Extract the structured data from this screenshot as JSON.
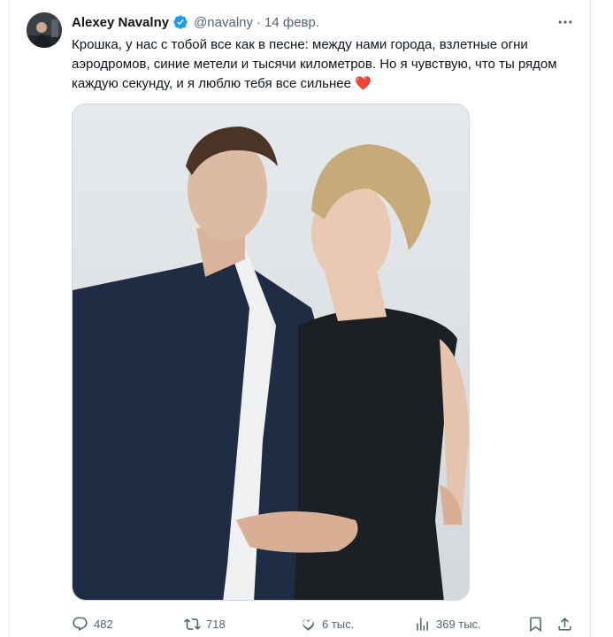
{
  "tweet": {
    "author_name": "Alexey Navalny",
    "handle": "@navalny",
    "separator": "·",
    "date": "14 февр.",
    "text": "Крошка, у нас с тобой все как в песне: между нами города, взлетные огни аэродромов, синие метели и тысячи километров. Но я чувствую, что ты рядом каждую секунду, и я люблю тебя все сильнее",
    "emoji": "❤️",
    "verified": true
  },
  "actions": {
    "replies": "482",
    "retweets": "718",
    "likes": "6 тыс.",
    "views": "369 тыс."
  },
  "icons": {
    "more": "more-horizontal-icon",
    "reply": "reply-icon",
    "retweet": "retweet-icon",
    "like": "heart-icon",
    "views": "views-bar-chart-icon",
    "bookmark": "bookmark-icon",
    "share": "share-icon"
  },
  "colors": {
    "text_primary": "#0f1419",
    "text_secondary": "#536471",
    "verified_blue": "#1d9bf0",
    "border": "#cfd9de"
  }
}
